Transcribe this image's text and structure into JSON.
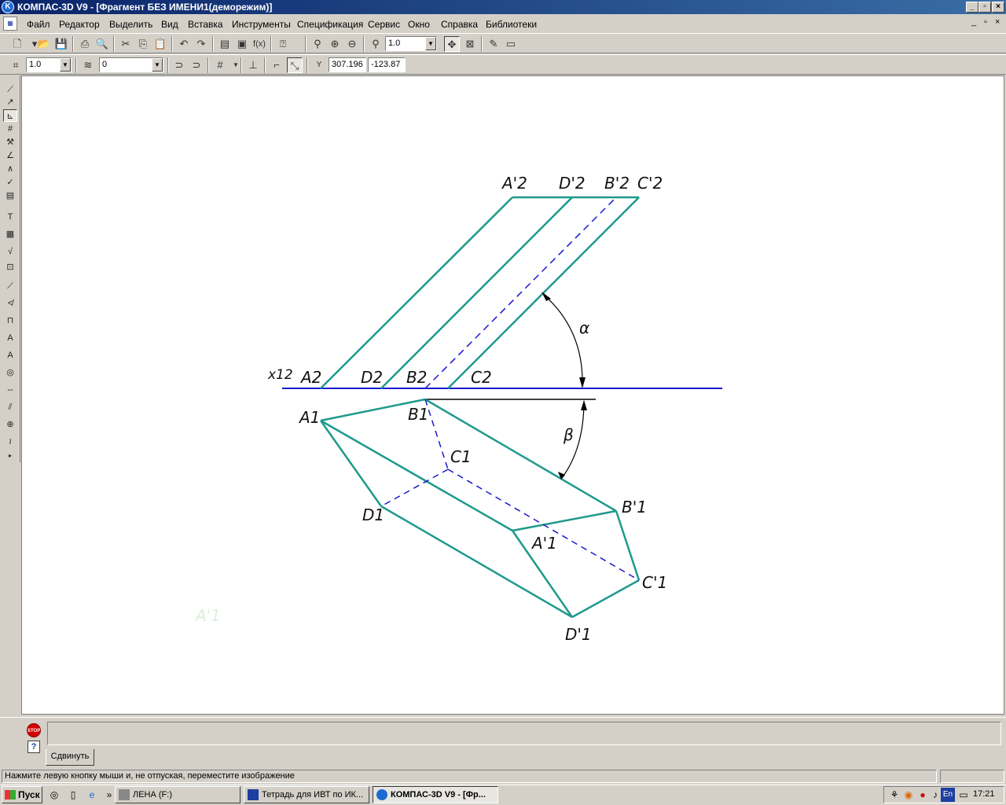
{
  "window": {
    "title": "КОМПАС-3D V9 - [Фрагмент БЕЗ ИМЕНИ1(деморежим)]",
    "app_icon": "K"
  },
  "menu": {
    "items": [
      "Файл",
      "Редактор",
      "Выделить",
      "Вид",
      "Вставка",
      "Инструменты",
      "Спецификация",
      "Сервис",
      "Окно",
      "Справка",
      "Библиотеки"
    ]
  },
  "toolbar1": {
    "zoom_value": "1.0"
  },
  "toolbar2": {
    "step_value": "1.0",
    "layer_value": "0",
    "coord_x": "307.196",
    "coord_y": "-123.87",
    "coord_label": "Y"
  },
  "drawing": {
    "line_color": "#1e9a8c",
    "axis_color": "#1a1acc",
    "hidden_color": "#1a1acc",
    "labels": {
      "a2p": "A'2",
      "d2p": "D'2",
      "b2p": "B'2",
      "c2p": "C'2",
      "x12": "x12",
      "a2": "A2",
      "d2": "D2",
      "b2": "B2",
      "c2": "C2",
      "a1": "A1",
      "b1": "B1",
      "c1": "C1",
      "d1": "D1",
      "b1p": "B'1",
      "a1p": "A'1",
      "c1p": "C'1",
      "d1p": "D'1",
      "alpha": "α",
      "beta": "β",
      "ghost": "A'1"
    }
  },
  "bottom": {
    "stop_label": "STOP",
    "help_label": "?",
    "tab_label": "Сдвинуть"
  },
  "status": {
    "text": "Нажмите левую кнопку мыши и, не отпуская, переместите изображение"
  },
  "taskbar": {
    "start_label": "Пуск",
    "tasks": [
      "ЛЕНА (F:)",
      "Тетрадь для ИВТ по ИК...",
      "КОМПАС-3D V9 - [Фр..."
    ],
    "clock": "17:21",
    "lang": "En"
  }
}
